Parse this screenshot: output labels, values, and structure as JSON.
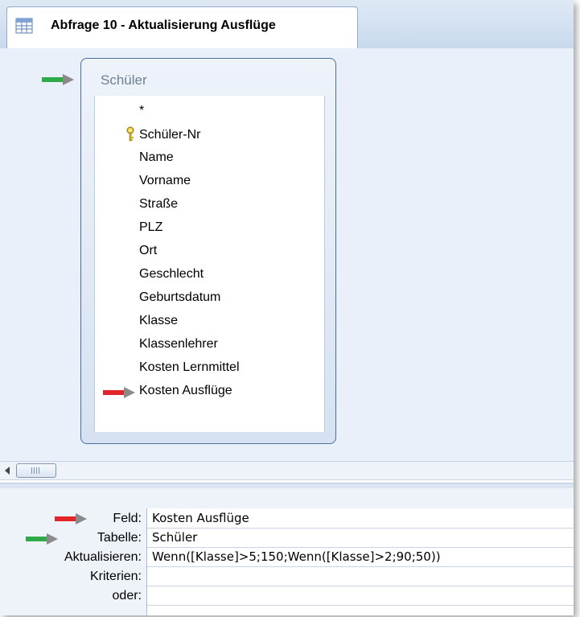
{
  "tab": {
    "title": "Abfrage 10 - Aktualisierung Ausflüge",
    "icon": "query-icon"
  },
  "table": {
    "title": "Schüler",
    "fields": [
      "*",
      "Schüler-Nr",
      "Name",
      "Vorname",
      "Straße",
      "PLZ",
      "Ort",
      "Geschlecht",
      "Geburtsdatum",
      "Klasse",
      "Klassenlehrer",
      "Kosten Lernmittel",
      "Kosten Ausflüge"
    ],
    "primary_key_field": "Schüler-Nr"
  },
  "grid": {
    "labels": {
      "feld": "Feld:",
      "tabelle": "Tabelle:",
      "aktualisieren": "Aktualisieren:",
      "kriterien": "Kriterien:",
      "oder": "oder:"
    },
    "values": {
      "feld": "Kosten Ausflüge",
      "tabelle": "Schüler",
      "aktualisieren": "Wenn([Klasse]>5;150;Wenn([Klasse]>2;90;50))",
      "kriterien": "",
      "oder": ""
    }
  },
  "colors": {
    "green_arrow": "#2eaa4a",
    "red_arrow": "#e0262a",
    "arrow_tip": "#8a8a8a"
  }
}
